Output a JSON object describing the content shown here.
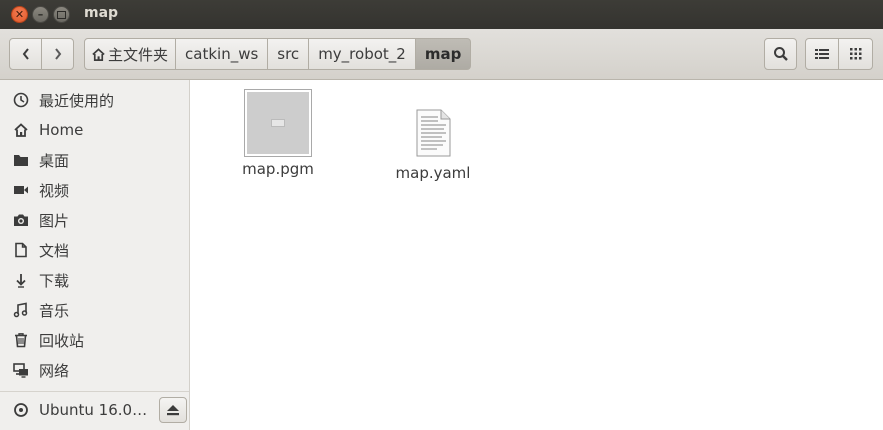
{
  "window": {
    "title": "map"
  },
  "toolbar": {
    "breadcrumbs": [
      {
        "label": "主文件夹"
      },
      {
        "label": "catkin_ws"
      },
      {
        "label": "src"
      },
      {
        "label": "my_robot_2"
      },
      {
        "label": "map"
      }
    ]
  },
  "sidebar": {
    "items": [
      {
        "label": "最近使用的",
        "icon": "recent-icon"
      },
      {
        "label": "Home",
        "icon": "home-icon"
      },
      {
        "label": "桌面",
        "icon": "folder-icon"
      },
      {
        "label": "视频",
        "icon": "video-icon"
      },
      {
        "label": "图片",
        "icon": "camera-icon"
      },
      {
        "label": "文档",
        "icon": "document-icon"
      },
      {
        "label": "下载",
        "icon": "download-icon"
      },
      {
        "label": "音乐",
        "icon": "music-icon"
      },
      {
        "label": "回收站",
        "icon": "trash-icon"
      },
      {
        "label": "网络",
        "icon": "network-icon"
      }
    ],
    "devices": [
      {
        "label": "Ubuntu 16.0…",
        "icon": "disc-icon"
      }
    ]
  },
  "files": [
    {
      "name": "map.pgm",
      "type": "image"
    },
    {
      "name": "map.yaml",
      "type": "text"
    }
  ],
  "colors": {
    "close_button": "#e05a2b",
    "titlebar": "#3b3a36",
    "sidebar_bg": "#f0efed"
  }
}
